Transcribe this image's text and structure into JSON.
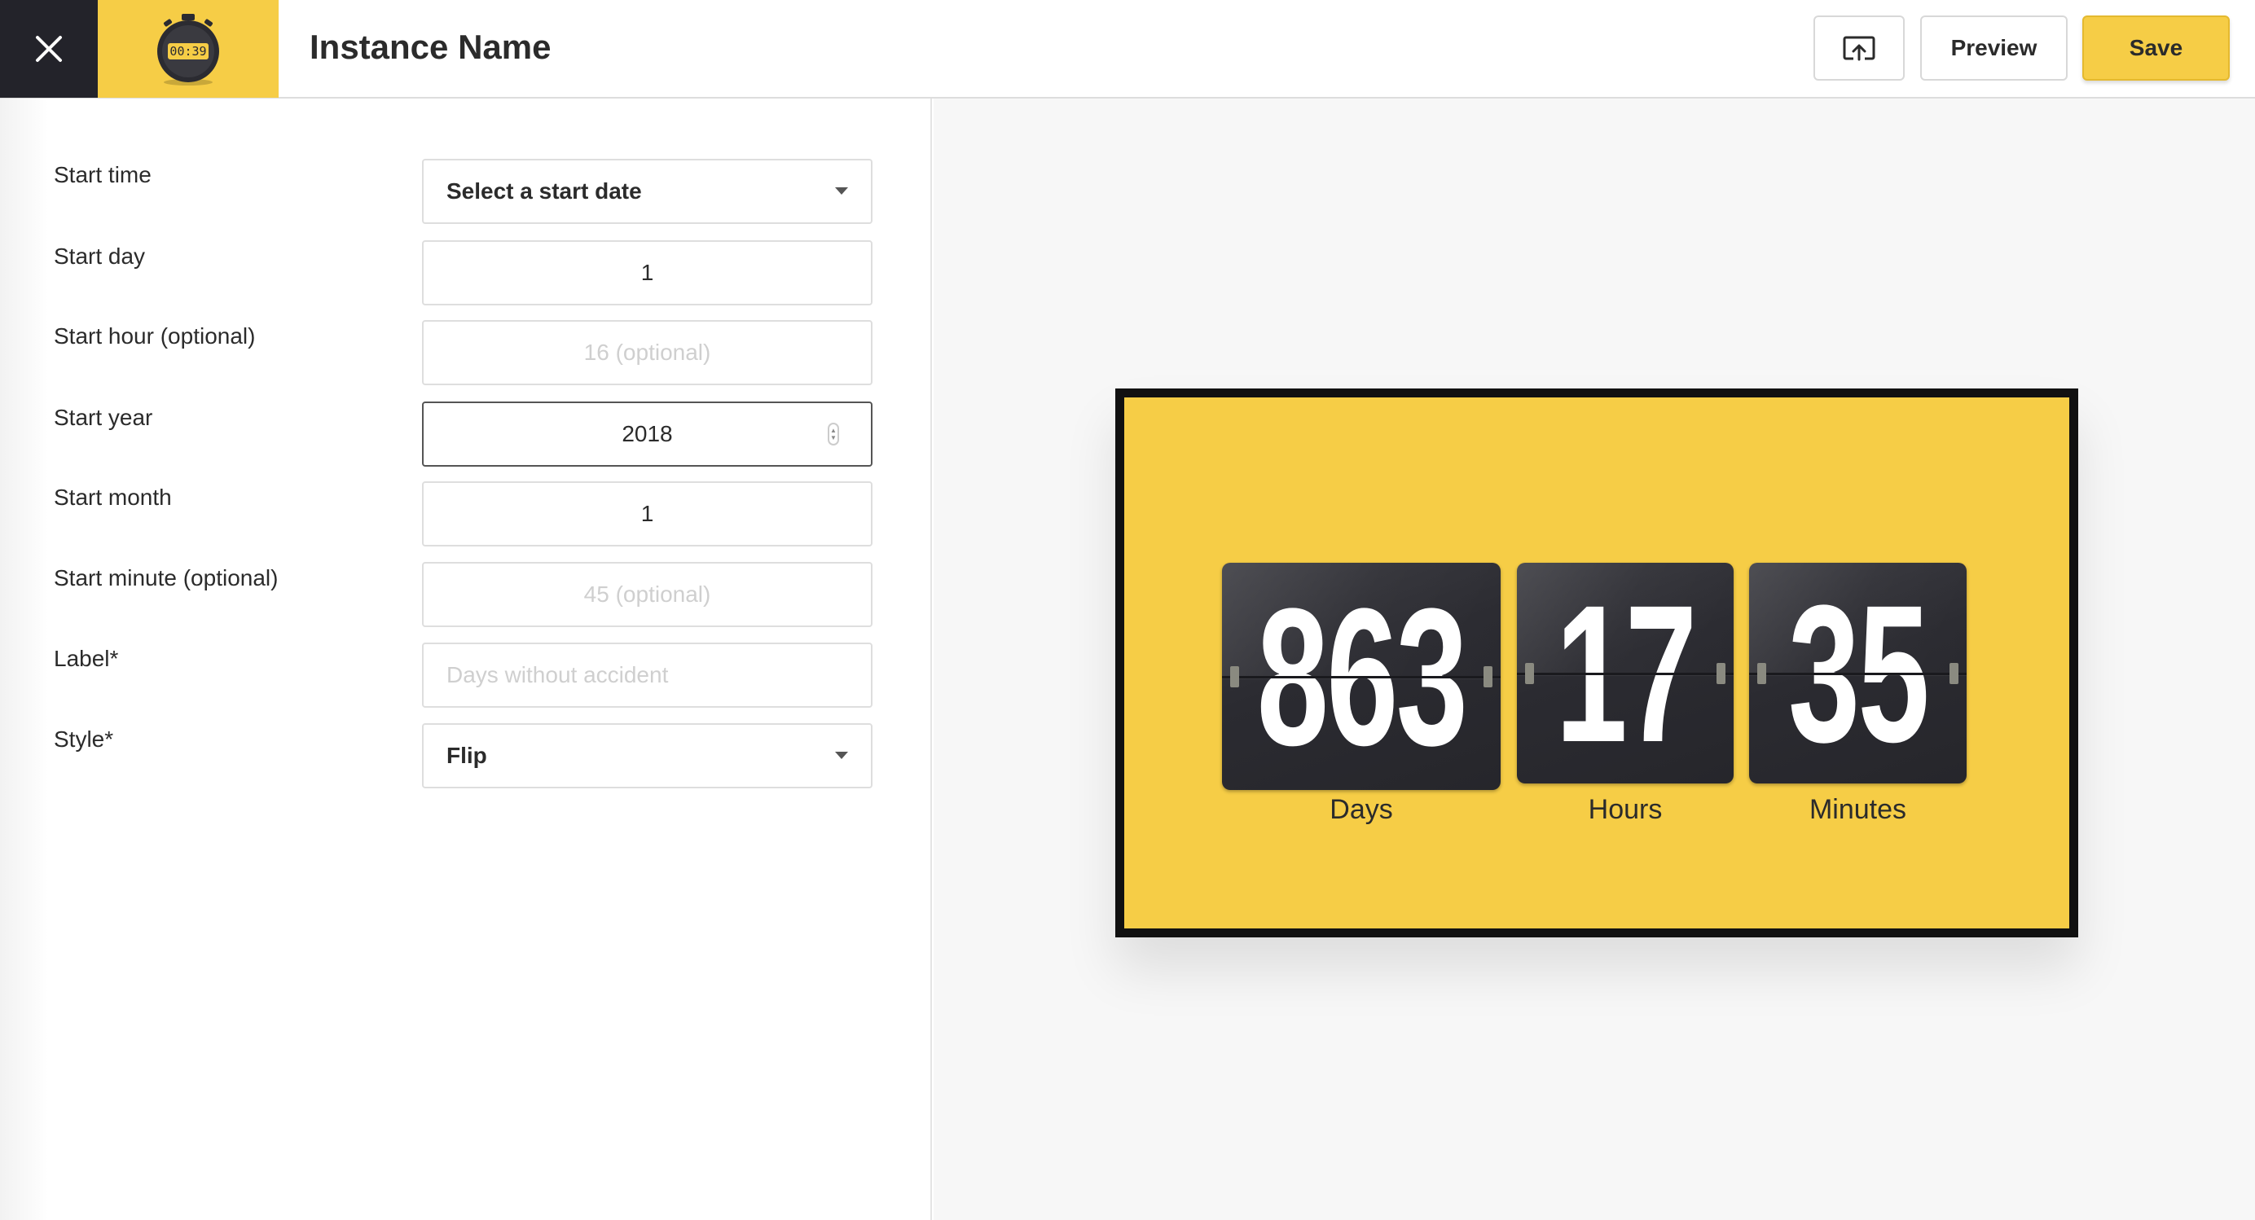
{
  "header": {
    "title": "Instance Name",
    "logo_text": "00:39",
    "preview_label": "Preview",
    "save_label": "Save",
    "accent_color": "#f6cd46",
    "dark_color": "#23232a"
  },
  "form": {
    "start_time": {
      "label": "Start time",
      "value": "Select a start date"
    },
    "start_day": {
      "label": "Start day",
      "value": "1"
    },
    "start_hour": {
      "label": "Start hour (optional)",
      "value": "",
      "placeholder": "16 (optional)"
    },
    "start_year": {
      "label": "Start year",
      "value": "2018"
    },
    "start_month": {
      "label": "Start month",
      "value": "1"
    },
    "start_minute": {
      "label": "Start minute (optional)",
      "value": "",
      "placeholder": "45 (optional)"
    },
    "label": {
      "label": "Label*",
      "value": "",
      "placeholder": "Days without accident"
    },
    "style": {
      "label": "Style*",
      "value": "Flip"
    }
  },
  "preview": {
    "days": {
      "value": "863",
      "label": "Days"
    },
    "hours": {
      "value": "17",
      "label": "Hours"
    },
    "minutes": {
      "value": "35",
      "label": "Minutes"
    }
  }
}
